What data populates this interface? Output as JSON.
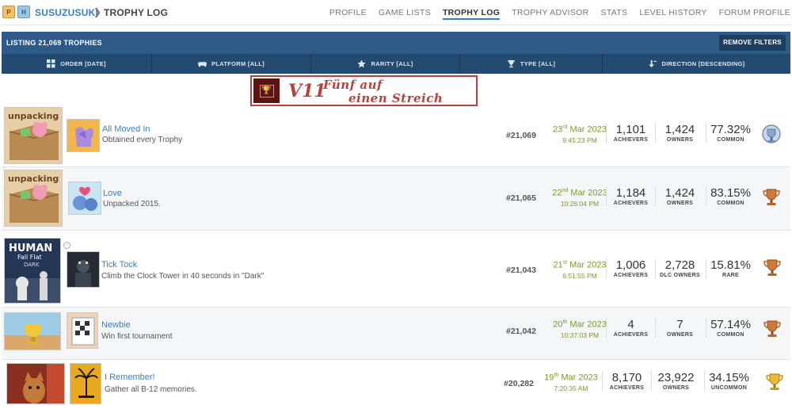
{
  "nav": {
    "badge_p": "P",
    "badge_h": "H",
    "username": "SUSUZUSUKI",
    "separator": "❯",
    "section": "TROPHY LOG",
    "links": [
      "PROFILE",
      "GAME LISTS",
      "TROPHY LOG",
      "TROPHY ADVISOR",
      "STATS",
      "LEVEL HISTORY",
      "FORUM PROFILE"
    ],
    "active": "TROPHY LOG"
  },
  "listing": {
    "title": "LISTING 21,069 TROPHIES",
    "remove_filters": "REMOVE FILTERS"
  },
  "filters": [
    {
      "label": "ORDER [DATE]",
      "icon": "grid-icon"
    },
    {
      "label": "PLATFORM [ALL]",
      "icon": "gamepad-icon"
    },
    {
      "label": "RARITY [ALL]",
      "icon": "star-icon"
    },
    {
      "label": "TYPE [ALL]",
      "icon": "trophy-icon"
    },
    {
      "label": "DIRECTION [DESCENDING]",
      "icon": "sort-down-icon"
    }
  ],
  "banner": {
    "version": "V11",
    "line1": "Fünf auf",
    "line2": "einen Streich"
  },
  "trophies": [
    {
      "name": "All Moved In",
      "desc": "Obtained every Trophy",
      "rank": "#21,069",
      "day": "23",
      "suffix": "rd",
      "monthyear": " Mar 2023",
      "time": "9:45:23 PM",
      "achievers": "1,101",
      "achievers_label": "ACHIEVERS",
      "owners": "1,424",
      "owners_label": "OWNERS",
      "pct": "77.32%",
      "rarity": "COMMON",
      "type": "platinum",
      "game": "unpacking"
    },
    {
      "name": "Love",
      "desc": "Unpacked 2015.",
      "rank": "#21,065",
      "day": "22",
      "suffix": "nd",
      "monthyear": " Mar 2023",
      "time": "10:26:04 PM",
      "achievers": "1,184",
      "achievers_label": "ACHIEVERS",
      "owners": "1,424",
      "owners_label": "OWNERS",
      "pct": "83.15%",
      "rarity": "COMMON",
      "type": "bronze",
      "game": "unpacking"
    },
    {
      "name": "Tick Tock",
      "desc": "Climb the Clock Tower in 40 seconds in \"Dark\"",
      "rank": "#21,043",
      "day": "21",
      "suffix": "st",
      "monthyear": " Mar 2023",
      "time": "6:51:55 PM",
      "achievers": "1,006",
      "achievers_label": "ACHIEVERS",
      "owners": "2,728",
      "owners_label": "DLC OWNERS",
      "pct": "15.81%",
      "rarity": "RARE",
      "type": "bronze",
      "game": "human-fall-flat"
    },
    {
      "name": "Newbie",
      "desc": "Win first tournament",
      "rank": "#21,042",
      "day": "20",
      "suffix": "th",
      "monthyear": " Mar 2023",
      "time": "10:37:03 PM",
      "achievers": "4",
      "achievers_label": "ACHIEVERS",
      "owners": "7",
      "owners_label": "OWNERS",
      "pct": "57.14%",
      "rarity": "COMMON",
      "type": "bronze",
      "game": "racing"
    },
    {
      "name": "I Remember!",
      "desc": "Gather all B-12 memories.",
      "rank": "#20,282",
      "day": "19",
      "suffix": "th",
      "monthyear": " Mar 2023",
      "time": "7:20:35 AM",
      "achievers": "8,170",
      "achievers_label": "ACHIEVERS",
      "owners": "23,922",
      "owners_label": "OWNERS",
      "pct": "34.15%",
      "rarity": "UNCOMMON",
      "type": "gold",
      "game": "stray"
    }
  ],
  "game_titles": {
    "unpacking": "unpacking",
    "human_line1": "HUMAN",
    "human_line2": "Fall Flat",
    "human_line3": "DARK"
  },
  "colors": {
    "header_bg": "#2d5a86",
    "filter_bg": "#234a70",
    "link": "#3a7fc1",
    "date": "#7a9a2a",
    "banner_red": "#b4423e"
  }
}
